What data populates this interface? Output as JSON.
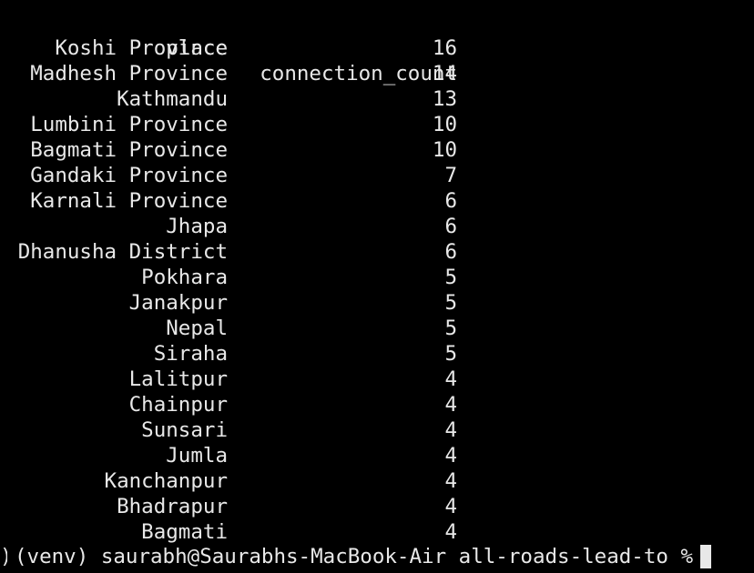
{
  "table": {
    "headers": {
      "place": "place",
      "count": "connection_count"
    },
    "rows": [
      {
        "place": "Koshi Province",
        "count": "16"
      },
      {
        "place": "Madhesh Province",
        "count": "14"
      },
      {
        "place": "Kathmandu",
        "count": "13"
      },
      {
        "place": "Lumbini Province",
        "count": "10"
      },
      {
        "place": "Bagmati Province",
        "count": "10"
      },
      {
        "place": "Gandaki Province",
        "count": "7"
      },
      {
        "place": "Karnali Province",
        "count": "6"
      },
      {
        "place": "Jhapa",
        "count": "6"
      },
      {
        "place": "Dhanusha District",
        "count": "6"
      },
      {
        "place": "Pokhara",
        "count": "5"
      },
      {
        "place": "Janakpur",
        "count": "5"
      },
      {
        "place": "Nepal",
        "count": "5"
      },
      {
        "place": "Siraha",
        "count": "5"
      },
      {
        "place": "Lalitpur",
        "count": "4"
      },
      {
        "place": "Chainpur",
        "count": "4"
      },
      {
        "place": "Sunsari",
        "count": "4"
      },
      {
        "place": "Jumla",
        "count": "4"
      },
      {
        "place": "Kanchanpur",
        "count": "4"
      },
      {
        "place": "Bhadrapur",
        "count": "4"
      },
      {
        "place": "Bagmati",
        "count": "4"
      }
    ]
  },
  "prompt": {
    "text": "(venv) saurabh@Saurabhs-MacBook-Air all-roads-lead-to %"
  },
  "colors": {
    "background": "#000000",
    "foreground": "#e8e8e8"
  }
}
